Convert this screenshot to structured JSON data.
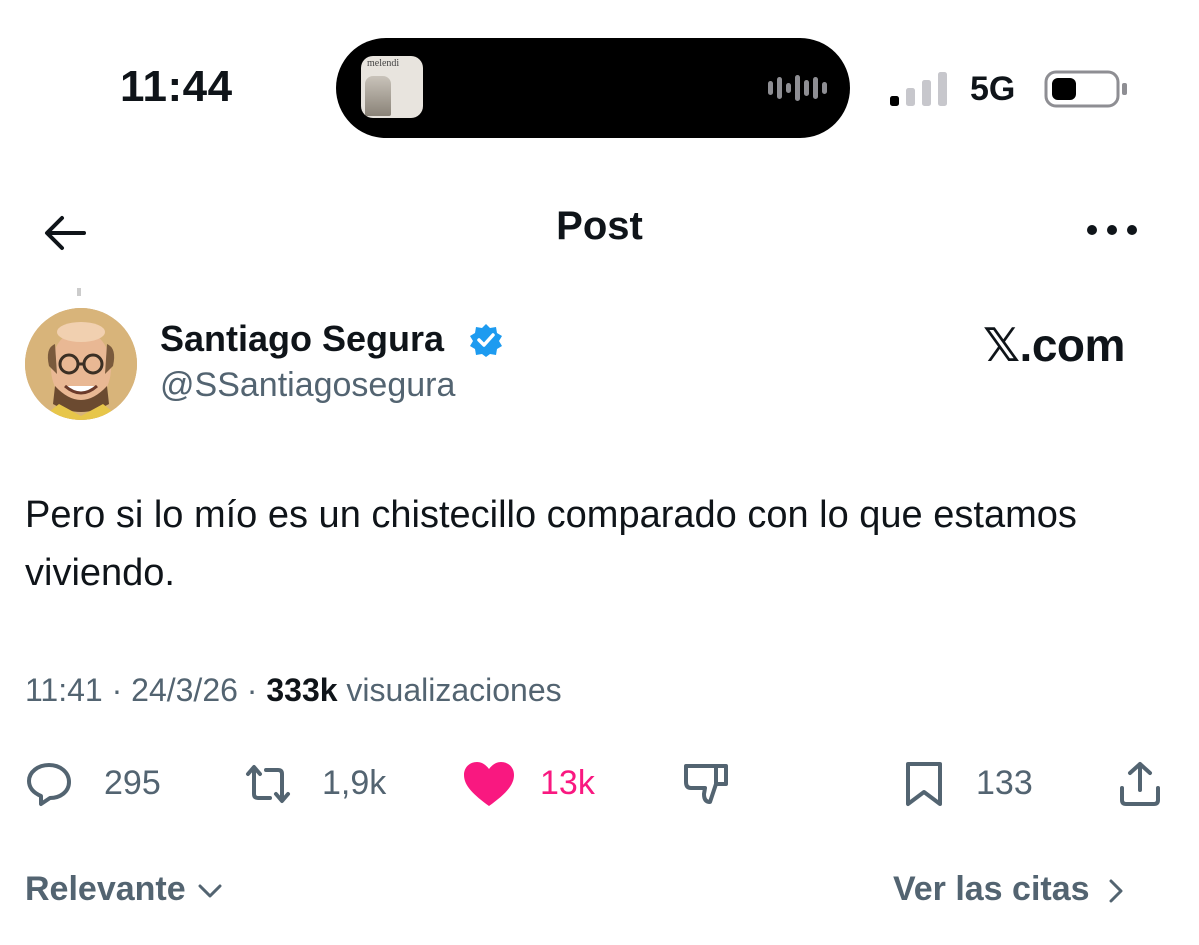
{
  "status_bar": {
    "time": "11:44",
    "network": "5G",
    "now_playing": {
      "album_text": "melendi"
    }
  },
  "header": {
    "title": "Post"
  },
  "author": {
    "name": "Santiago Segura",
    "handle": "@SSantiagosegura",
    "verified": true,
    "watermark": "𝕏.com"
  },
  "post": {
    "text": "Pero si lo mío es un chistecillo comparado con lo que estamos viviendo.",
    "time": "11:41",
    "date": "24/3/26",
    "views": "333k",
    "views_label": "visualizaciones"
  },
  "actions": {
    "replies": "295",
    "reposts": "1,9k",
    "likes": "13k",
    "bookmarks": "133"
  },
  "footer": {
    "sort_label": "Relevante",
    "quotes_label": "Ver las citas"
  },
  "colors": {
    "text": "#0f1419",
    "secondary": "#536471",
    "like": "#f91880",
    "verified": "#1d9bf0"
  }
}
